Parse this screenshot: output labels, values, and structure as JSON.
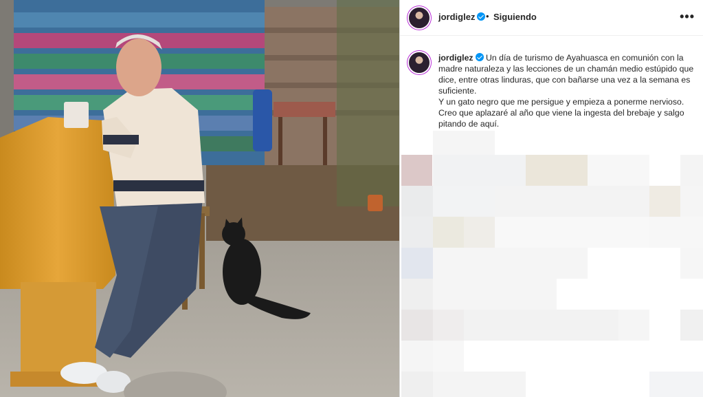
{
  "post": {
    "username": "jordiglez",
    "separator": "•",
    "follow_status": "Siguiendo",
    "more_label": "•••",
    "caption_username": "jordiglez",
    "caption_text": "Un día de turismo de Ayahuasca en comunión con la madre naturaleza y las lecciones de un chamán medio estúpido que dice, entre otras linduras, que con bañarse una vez a la semana es suficiente.\nY un gato negro que me persigue y empieza a ponerme nervioso. Creo que aplazaré al año que viene la ingesta del brebaje y salgo pitando de aquí."
  },
  "icons": {
    "verified": "verified-badge-icon",
    "more": "more-options-icon"
  },
  "colors": {
    "verified_blue": "#0095f6",
    "story_ring": "#b72bd6",
    "text": "#262626",
    "border": "#dbdbdb"
  }
}
